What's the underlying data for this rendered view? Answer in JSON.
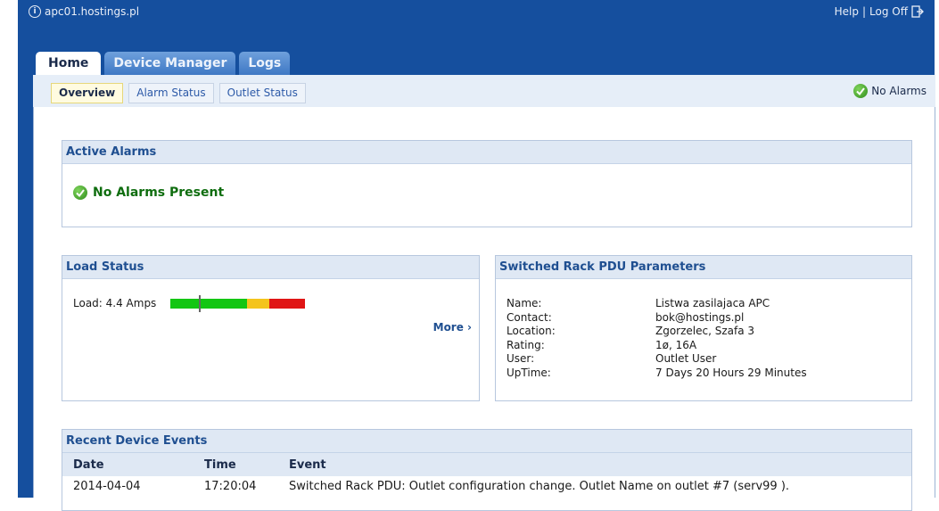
{
  "topbar": {
    "host": "apc01.hostings.pl",
    "help": "Help",
    "separator": "|",
    "logoff": "Log Off"
  },
  "tabs": [
    "Home",
    "Device Manager",
    "Logs"
  ],
  "subtabs": [
    "Overview",
    "Alarm Status",
    "Outlet Status"
  ],
  "alarm_status_top": "No Alarms",
  "active_alarms": {
    "title": "Active Alarms",
    "message": "No Alarms Present"
  },
  "load_status": {
    "title": "Load Status",
    "label": "Load: 4.4 Amps",
    "load_fraction": 0.21,
    "more": "More ›"
  },
  "pdu_params": {
    "title": "Switched Rack PDU Parameters",
    "rows": [
      {
        "k": "Name:",
        "v": "Listwa zasilajaca APC"
      },
      {
        "k": "Contact:",
        "v": "bok@hostings.pl"
      },
      {
        "k": "Location:",
        "v": "Zgorzelec, Szafa 3"
      },
      {
        "k": "Rating:",
        "v": "1ø, 16A"
      },
      {
        "k": "User:",
        "v": "Outlet User"
      },
      {
        "k": "UpTime:",
        "v": "7 Days 20 Hours 29 Minutes"
      }
    ]
  },
  "recent_events": {
    "title": "Recent Device Events",
    "columns": [
      "Date",
      "Time",
      "Event"
    ],
    "rows": [
      {
        "date": "2014-04-04",
        "time": "17:20:04",
        "event": "Switched Rack PDU: Outlet configuration change. Outlet Name on outlet #7 (serv99 )."
      }
    ]
  },
  "colors": {
    "frame": "#154f9e",
    "header_text": "#1f4f91",
    "ok_green": "#0f6d0f"
  }
}
